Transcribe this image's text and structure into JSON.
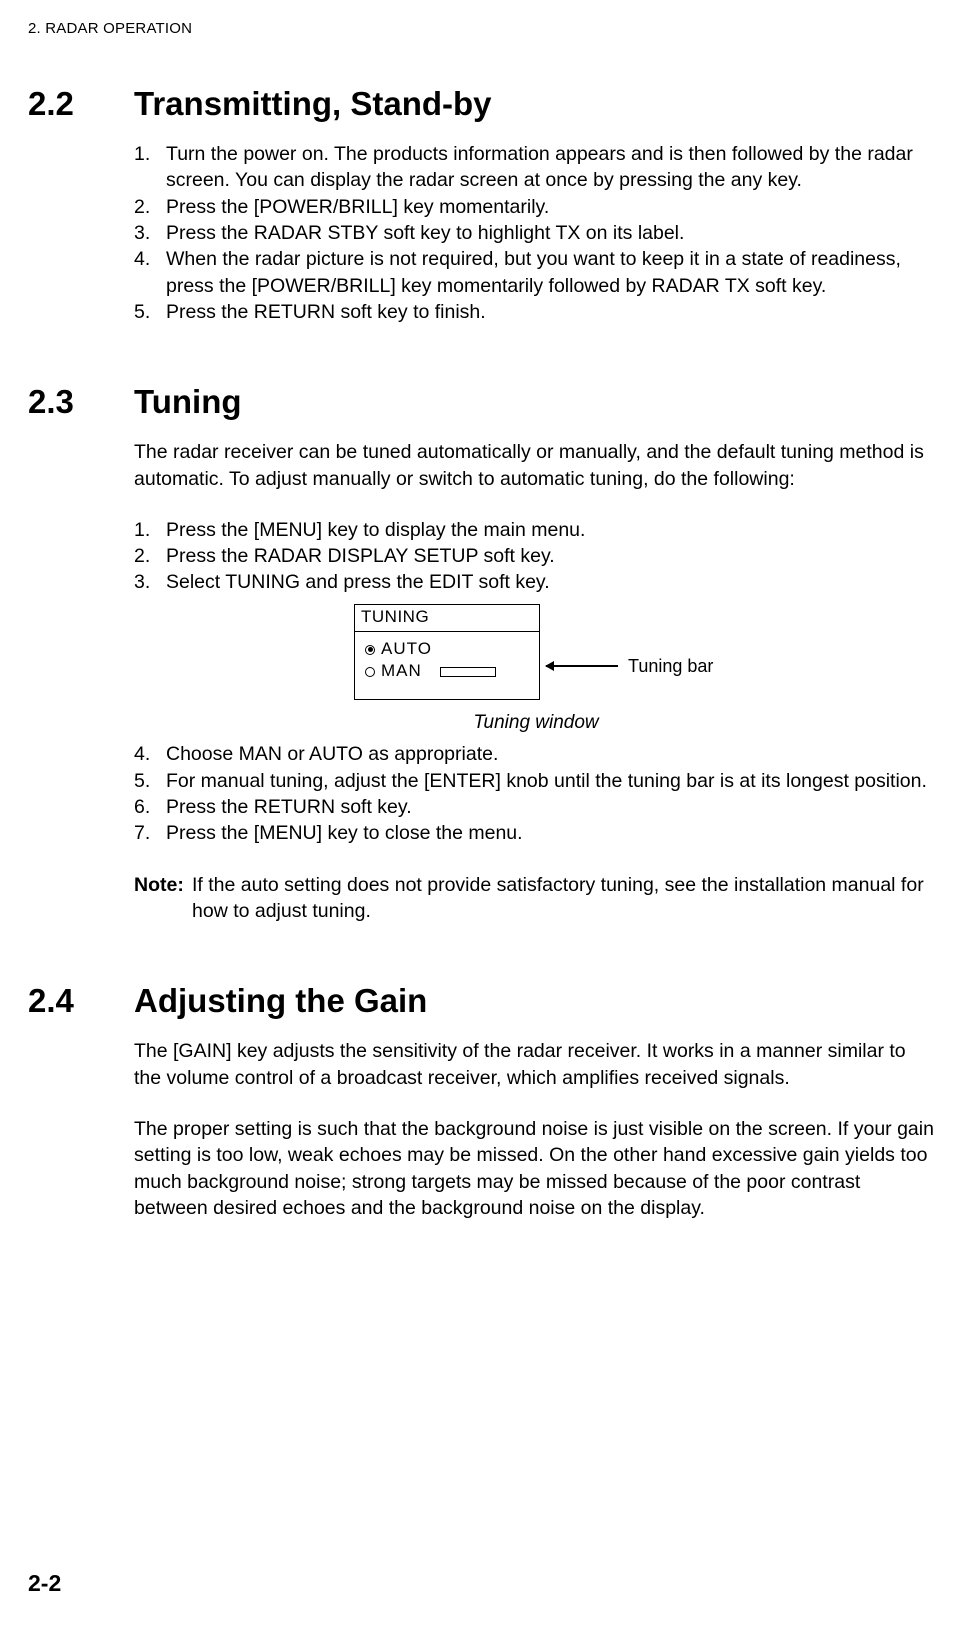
{
  "runningHeader": "2. RADAR OPERATION",
  "pageNumber": "2-2",
  "sections": [
    {
      "number": "2.2",
      "title": "Transmitting, Stand-by",
      "blocks": [
        {
          "type": "ol",
          "items": [
            {
              "n": "1.",
              "t": "Turn the power on. The products information appears and is then followed by the radar screen. You can display the radar screen at once by pressing the any key."
            },
            {
              "n": "2.",
              "t": "Press the [POWER/BRILL] key momentarily."
            },
            {
              "n": "3.",
              "t": "Press the RADAR STBY soft key to highlight TX on its label."
            },
            {
              "n": "4.",
              "t": "When the radar picture is not required, but you want to keep it in a state of readiness, press the [POWER/BRILL] key momentarily followed by RADAR TX soft key."
            },
            {
              "n": "5.",
              "t": "Press the RETURN soft key to finish."
            }
          ]
        }
      ]
    },
    {
      "number": "2.3",
      "title": "Tuning",
      "blocks": [
        {
          "type": "para",
          "text": "The radar receiver can be tuned automatically or manually, and the default tuning method is automatic. To adjust manually or switch to automatic tuning, do the following:"
        },
        {
          "type": "ol",
          "items": [
            {
              "n": "1.",
              "t": "Press the [MENU] key to display the main menu."
            },
            {
              "n": "2.",
              "t": "Press the RADAR DISPLAY SETUP soft key."
            },
            {
              "n": "3.",
              "t": "Select TUNING and press the EDIT soft key."
            }
          ]
        },
        {
          "type": "figure",
          "box": {
            "title": "TUNING",
            "opts": [
              "AUTO",
              "MAN"
            ]
          },
          "callout": "Tuning bar",
          "caption": "Tuning window"
        },
        {
          "type": "ol",
          "items": [
            {
              "n": "4.",
              "t": "Choose MAN or AUTO as appropriate."
            },
            {
              "n": "5.",
              "t": "For manual tuning, adjust the [ENTER] knob until the tuning bar is at its longest position."
            },
            {
              "n": "6.",
              "t": "Press the RETURN soft key."
            },
            {
              "n": "7.",
              "t": "Press the [MENU] key to close the menu."
            }
          ]
        },
        {
          "type": "note",
          "label": "Note:",
          "text": " If the auto setting does not provide satisfactory tuning, see the installation manual for how to adjust tuning."
        }
      ]
    },
    {
      "number": "2.4",
      "title": "Adjusting the Gain",
      "blocks": [
        {
          "type": "para",
          "text": "The [GAIN] key adjusts the sensitivity of the radar receiver. It works in a manner similar to the volume control of a broadcast receiver, which amplifies received signals."
        },
        {
          "type": "para",
          "text": "The proper setting is such that the background noise is just visible on the screen. If your gain setting is too low, weak echoes may be missed. On the other hand excessive gain yields too much background noise; strong targets may be missed because of the poor contrast between desired echoes and the background noise on the display."
        }
      ]
    }
  ]
}
